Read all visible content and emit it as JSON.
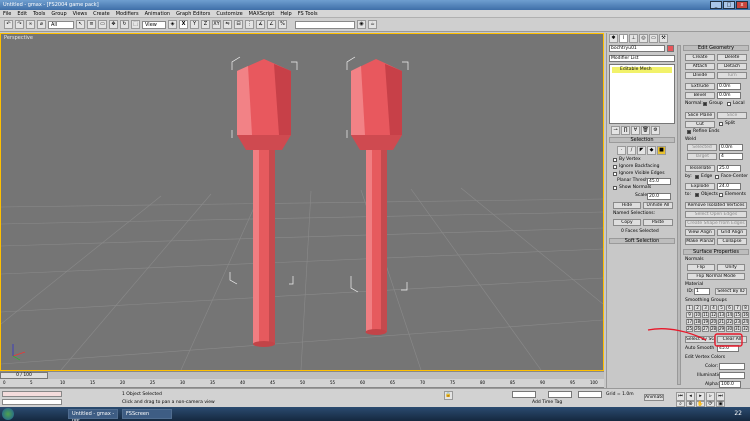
{
  "window": {
    "title": "Untitled - gmax - [FS2004 game pack]",
    "buttons": [
      "_",
      "□",
      "x"
    ]
  },
  "menubar": [
    "File",
    "Edit",
    "Tools",
    "Group",
    "Views",
    "Create",
    "Modifiers",
    "Animation",
    "Graph Editors",
    "Customize",
    "MAXScript",
    "Help",
    "FS Tools"
  ],
  "toolbar": {
    "selection_filter": "All",
    "ref_coord": "View",
    "axis_labels": [
      "X",
      "Y",
      "Z",
      "XY"
    ],
    "named_sel": ""
  },
  "viewport": {
    "label": "Perspective"
  },
  "command_panel": {
    "object_name": "bochtryu01",
    "modifier_list": "Modifier List",
    "stack_item": "Editable Mesh",
    "selection": {
      "title": "Selection",
      "by_vertex": "By Vertex",
      "ignore_backfacing": "Ignore Backfacing",
      "ignore_visible_edges": "Ignore Visible Edges",
      "planar_thresh_label": "Planar Thresh:",
      "planar_thresh_value": "45.0",
      "show_normals": "Show Normals",
      "scale_label": "Scale:",
      "scale_value": "20.0",
      "hide": "Hide",
      "unhide_all": "Unhide All",
      "named_selections": "Named Selections:",
      "copy": "Copy",
      "paste": "Paste",
      "status": "0 Faces Selected"
    },
    "soft_selection": "Soft Selection",
    "edit_geometry": {
      "title": "Edit Geometry",
      "create": "Create",
      "delete": "Delete",
      "attach": "Attach",
      "detach": "Detach",
      "divide": "Divide",
      "turn": "Turn",
      "extrude": "Extrude",
      "extrude_value": "0.0m",
      "bevel": "Bevel",
      "bevel_value": "0.0m",
      "normal_label": "Normal:",
      "group": "Group",
      "local": "Local",
      "slice_plane": "Slice Plane",
      "slice": "Slice",
      "cut": "Cut",
      "split": "Split",
      "refine_ends": "Refine Ends",
      "weld": "Weld",
      "selected": "Selected",
      "selected_value": "0.0m",
      "target": "Target",
      "target_value": "4",
      "tessellate": "Tessellate",
      "tessellate_value": "25.0",
      "by_label": "by:",
      "edge": "Edge",
      "face_center": "Face-Center",
      "explode": "Explode",
      "explode_value": "24.0",
      "to_label": "to:",
      "objects": "Objects",
      "elements": "Elements",
      "remove_isolated": "Remove Isolated Vertices",
      "select_open_edges": "Select Open Edges",
      "create_shape": "Create Shape from Edges",
      "view_align": "View Align",
      "grid_align": "Grid Align",
      "make_planar": "Make Planar",
      "collapse": "Collapse"
    },
    "surface_properties": {
      "title": "Surface Properties",
      "normals": "Normals",
      "flip": "Flip",
      "unify": "Unify",
      "flip_normal_mode": "Flip Normal Mode",
      "material": "Material",
      "id_label": "ID:",
      "id_value": "1",
      "select_by_id": "Select By ID",
      "smoothing_groups": "Smoothing Groups",
      "sg_numbers": [
        "1",
        "2",
        "3",
        "4",
        "5",
        "6",
        "7",
        "8",
        "9",
        "10",
        "11",
        "12",
        "13",
        "14",
        "15",
        "16",
        "17",
        "18",
        "19",
        "20",
        "21",
        "22",
        "23",
        "24",
        "25",
        "26",
        "27",
        "28",
        "29",
        "30",
        "31",
        "32"
      ],
      "select_by_sg": "Select By SG",
      "clear_all": "Clear All",
      "auto_smooth": "Auto Smooth",
      "auto_smooth_value": "45.0",
      "edit_vertex_colors": "Edit Vertex Colors",
      "color": "Color:",
      "illumination": "Illumination:",
      "alpha": "Alpha:",
      "alpha_value": "100.0"
    }
  },
  "timeline": {
    "slider": "0 / 100",
    "ticks": [
      "0",
      "5",
      "10",
      "15",
      "20",
      "25",
      "30",
      "35",
      "40",
      "45",
      "50",
      "55",
      "60",
      "65",
      "70",
      "75",
      "80",
      "85",
      "90",
      "95",
      "100"
    ]
  },
  "statusbar": {
    "selection_info": "1 Object Selected",
    "prompt": "Click and drag to pan a non-camera view",
    "add_time_tag": "Add Time Tag",
    "grid": "Grid = 1.0m",
    "animate": "Animate"
  },
  "taskbar": {
    "items": [
      "Untitled - gmax - [FS...",
      "FSScreen"
    ],
    "clock": "22"
  },
  "colors": {
    "viewport_bg": "#757575",
    "model": "#e8555a",
    "annotation": "#e8182a",
    "stack_highlight": "#f2f26a"
  }
}
